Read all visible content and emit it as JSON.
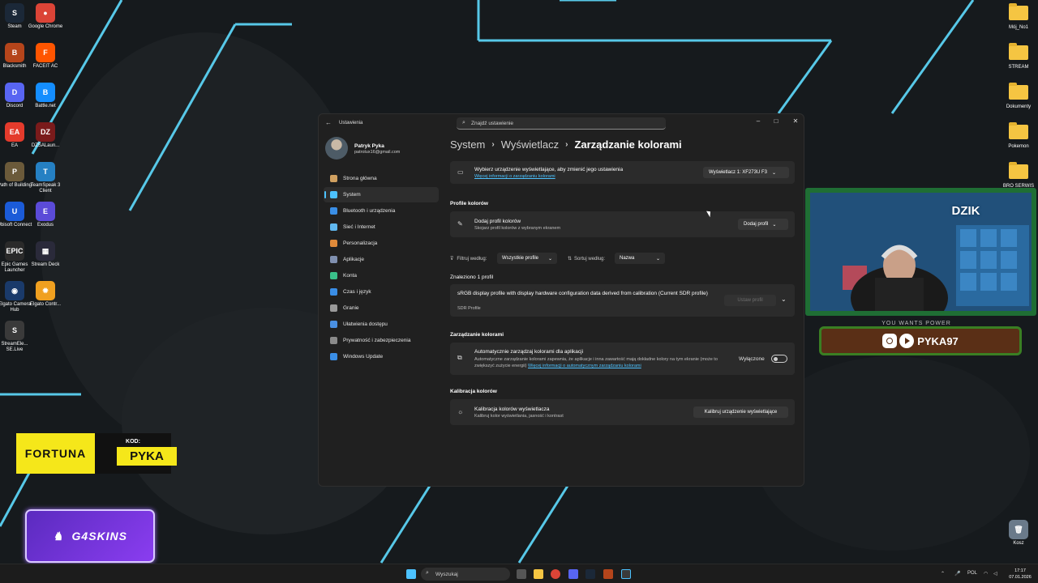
{
  "desktop": {
    "left_icons": [
      {
        "label": "Steam",
        "color": "#1b2838",
        "glyph": "S"
      },
      {
        "label": "Google Chrome",
        "color": "#db4437",
        "glyph": "●"
      },
      {
        "label": "Blacksmith",
        "color": "#b5451b",
        "glyph": "B"
      },
      {
        "label": "FACEIT AC",
        "color": "#ff5500",
        "glyph": "F"
      },
      {
        "label": "Discord",
        "color": "#5865f2",
        "glyph": "D"
      },
      {
        "label": "Battle.net",
        "color": "#148eff",
        "glyph": "B"
      },
      {
        "label": "EA",
        "color": "#e43b2c",
        "glyph": "EA"
      },
      {
        "label": "DZSALaun...",
        "color": "#7a1b1b",
        "glyph": "DZ"
      },
      {
        "label": "Path of Building",
        "color": "#6b5a3a",
        "glyph": "P"
      },
      {
        "label": "TeamSpeak 3 Client",
        "color": "#2580c3",
        "glyph": "T"
      },
      {
        "label": "Ubisoft Connect",
        "color": "#1b5bd8",
        "glyph": "U"
      },
      {
        "label": "Exodus",
        "color": "#5b4bd8",
        "glyph": "E"
      },
      {
        "label": "Epic Games Launcher",
        "color": "#2a2a2a",
        "glyph": "EPIC"
      },
      {
        "label": "Stream Deck",
        "color": "#2a2a3a",
        "glyph": "▦"
      },
      {
        "label": "Elgato Camera Hub",
        "color": "#1a3a6a",
        "glyph": "◉"
      },
      {
        "label": "Elgato Contr...",
        "color": "#f0a020",
        "glyph": "✹"
      },
      {
        "label": "StreamEle... SE.Live",
        "color": "#3a3a3a",
        "glyph": "S"
      }
    ],
    "right_icons": [
      {
        "label": "Mój_No1"
      },
      {
        "label": "STREAM"
      },
      {
        "label": "Dokumenty"
      },
      {
        "label": "Pokemon"
      },
      {
        "label": "BRO SERWIS"
      }
    ],
    "recycle_bin": "Kosz"
  },
  "settings": {
    "app_title": "Ustawienia",
    "search_placeholder": "Znajdź ustawienie",
    "user": {
      "name": "Patryk Pyka",
      "email": "patrolux16@gmail.com"
    },
    "nav": [
      {
        "label": "Strona główna",
        "color": "#d0a060",
        "active": false
      },
      {
        "label": "System",
        "color": "#4cc2ff",
        "active": true
      },
      {
        "label": "Bluetooth i urządzenia",
        "color": "#3a8ee6",
        "active": false
      },
      {
        "label": "Sieć i Internet",
        "color": "#60b8f0",
        "active": false
      },
      {
        "label": "Personalizacja",
        "color": "#e08a3a",
        "active": false
      },
      {
        "label": "Aplikacje",
        "color": "#8090b0",
        "active": false
      },
      {
        "label": "Konta",
        "color": "#3ac08a",
        "active": false
      },
      {
        "label": "Czas i język",
        "color": "#3a8ee6",
        "active": false
      },
      {
        "label": "Granie",
        "color": "#9a9a9a",
        "active": false
      },
      {
        "label": "Ułatwienia dostępu",
        "color": "#4a90e2",
        "active": false
      },
      {
        "label": "Prywatność i zabezpieczenia",
        "color": "#8a8a8a",
        "active": false
      },
      {
        "label": "Windows Update",
        "color": "#3a8ee6",
        "active": false
      }
    ],
    "breadcrumb": {
      "item1": "System",
      "item2": "Wyświetlacz",
      "item3": "Zarządzanie kolorami"
    },
    "display_card": {
      "title": "Wybierz urządzenie wyświetlające, aby zmienić jego ustawienia",
      "link": "Więcej informacji o zarządzaniu kolorami",
      "select": "Wyświetlacz 1: XF273U F3"
    },
    "profiles_heading": "Profile kolorów",
    "add_profile": {
      "title": "Dodaj profil kolorów",
      "subtitle": "Skojarz profil kolorów z wybranym ekranem",
      "button": "Dodaj profil"
    },
    "filter": {
      "filter_label": "Filtruj według:",
      "filter_value": "Wszystkie profile",
      "sort_label": "Sortuj według:",
      "sort_value": "Nazwa"
    },
    "found_label": "Znaleziono 1 profil",
    "profile_item": {
      "title": "sRGB display profile with display hardware configuration data derived from calibration (Current SDR profile)",
      "subtitle": "SDR Profile",
      "button": "Ustaw profil"
    },
    "color_mgmt_heading": "Zarządzanie kolorami",
    "auto_color": {
      "title": "Automatycznie zarządzaj kolorami dla aplikacji",
      "desc": "Automatyczne zarządzanie kolorami zapewnia, że aplikacje i inna zawartość mają dokładne kolory na tym ekranie (może to zwiększyć zużycie energii)",
      "link": "Więcej informacji o automatycznym zarządzaniu kolorami",
      "state": "Wyłączone"
    },
    "calibration_heading": "Kalibracja kolorów",
    "calibration": {
      "title": "Kalibracja kolorów wyświetlacza",
      "subtitle": "Kalibruj kolor wyświetlania, jasność i kontrast",
      "button": "Kalibruj urządzenie wyświetlające"
    }
  },
  "overlays": {
    "fortuna": {
      "brand": "FORTUNA",
      "code_label": "KOD:",
      "code": "PYKA"
    },
    "g4skins": "G4SKINS",
    "webcam_logo": "DZIK",
    "social_handle": "PYKA97",
    "banner_caption": "YOU WANTS POWER"
  },
  "taskbar": {
    "search_placeholder": "Wyszukaj",
    "lang": "POL",
    "time": "17:17",
    "date": "07.01.2026"
  }
}
